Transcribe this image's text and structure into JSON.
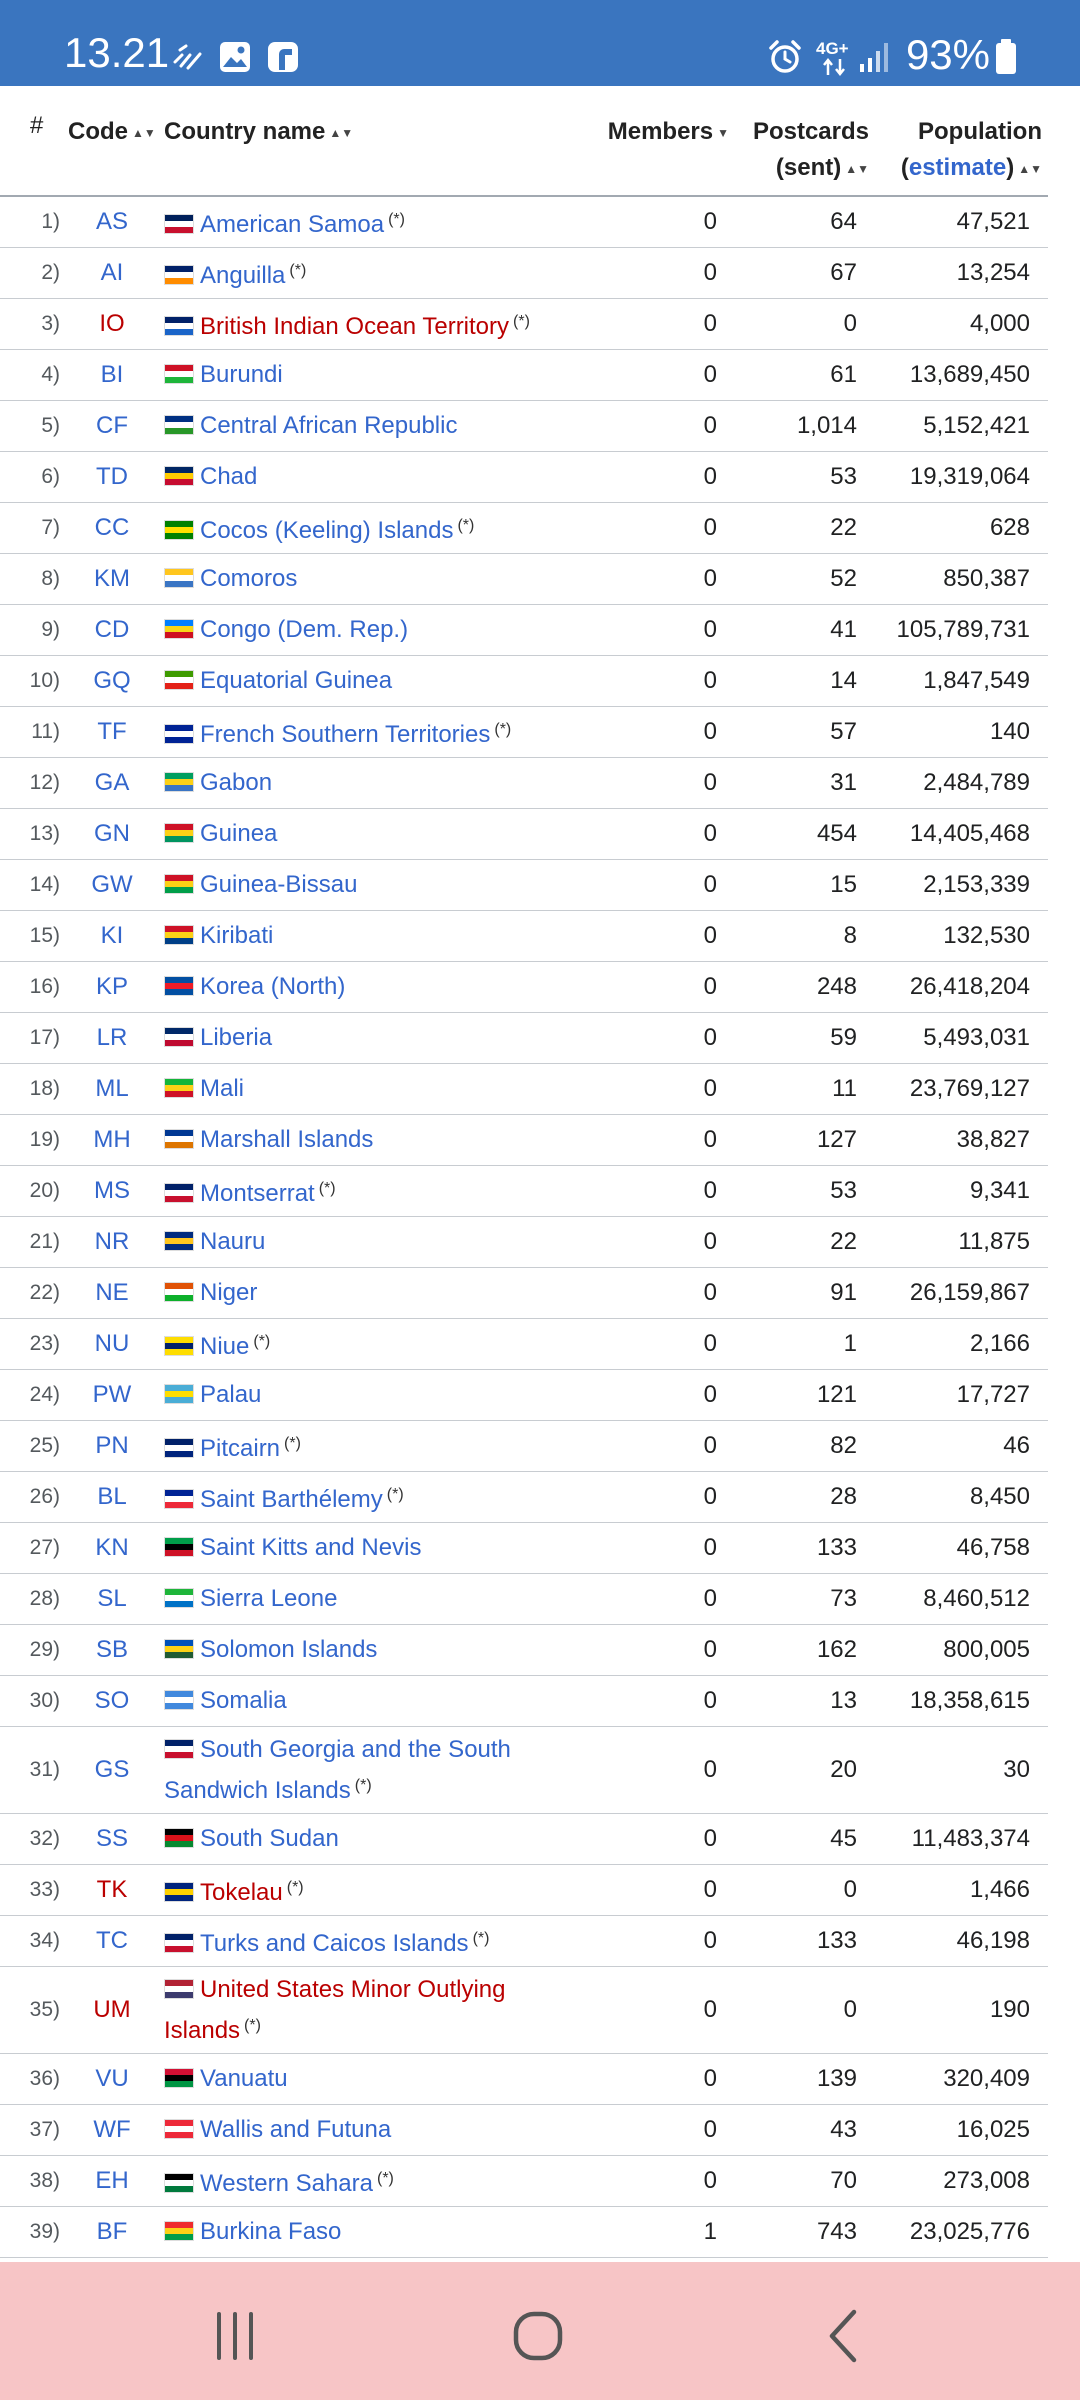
{
  "status_bar": {
    "time": "13.21",
    "network": "4G+",
    "battery": "93%",
    "icons": [
      "missed-call-icon",
      "gallery-icon",
      "app-f-icon",
      "alarm-icon",
      "network-4g-icon",
      "signal-icon",
      "battery-icon"
    ]
  },
  "table": {
    "headers": {
      "num": "#",
      "code": "Code",
      "name": "Country name",
      "members": "Members",
      "postcards_1": "Postcards",
      "postcards_2": "(sent)",
      "population_1": "Population",
      "population_open": "(",
      "population_link": "estimate",
      "population_close": ")"
    },
    "sort_glyph": "▲▼",
    "sort_glyph_members": "▼",
    "rows": [
      {
        "n": "1)",
        "code": "AS",
        "name": "American Samoa",
        "ast": "(*)",
        "members": "0",
        "postcards": "64",
        "population": "47,521",
        "flag": [
          "#00205b",
          "#ffffff",
          "#c8102e"
        ]
      },
      {
        "n": "2)",
        "code": "AI",
        "name": "Anguilla",
        "ast": "(*)",
        "members": "0",
        "postcards": "67",
        "population": "13,254",
        "flag": [
          "#012169",
          "#ffffff",
          "#ff8c00"
        ]
      },
      {
        "n": "3)",
        "code": "IO",
        "name": "British Indian Ocean Territory",
        "ast": "(*)",
        "members": "0",
        "postcards": "0",
        "population": "4,000",
        "flag": [
          "#012169",
          "#ffffff",
          "#1a64c8"
        ],
        "red": true
      },
      {
        "n": "4)",
        "code": "BI",
        "name": "Burundi",
        "ast": "",
        "members": "0",
        "postcards": "61",
        "population": "13,689,450",
        "flag": [
          "#ce1126",
          "#ffffff",
          "#1eb53a"
        ]
      },
      {
        "n": "5)",
        "code": "CF",
        "name": "Central African Republic",
        "ast": "",
        "members": "0",
        "postcards": "1,014",
        "population": "5,152,421",
        "flag": [
          "#003082",
          "#ffffff",
          "#289728"
        ]
      },
      {
        "n": "6)",
        "code": "TD",
        "name": "Chad",
        "ast": "",
        "members": "0",
        "postcards": "53",
        "population": "19,319,064",
        "flag": [
          "#002664",
          "#fecb00",
          "#c60c30"
        ]
      },
      {
        "n": "7)",
        "code": "CC",
        "name": "Cocos (Keeling) Islands",
        "ast": "(*)",
        "members": "0",
        "postcards": "22",
        "population": "628",
        "flag": [
          "#008000",
          "#ffe000",
          "#008000"
        ]
      },
      {
        "n": "8)",
        "code": "KM",
        "name": "Comoros",
        "ast": "",
        "members": "0",
        "postcards": "52",
        "population": "850,387",
        "flag": [
          "#ffc61e",
          "#ffffff",
          "#3a75c4"
        ]
      },
      {
        "n": "9)",
        "code": "CD",
        "name": "Congo (Dem. Rep.)",
        "ast": "",
        "members": "0",
        "postcards": "41",
        "population": "105,789,731",
        "flag": [
          "#007fff",
          "#f7d618",
          "#ce1021"
        ]
      },
      {
        "n": "10)",
        "code": "GQ",
        "name": "Equatorial Guinea",
        "ast": "",
        "members": "0",
        "postcards": "14",
        "population": "1,847,549",
        "flag": [
          "#3e9a00",
          "#ffffff",
          "#e32118"
        ]
      },
      {
        "n": "11)",
        "code": "TF",
        "name": "French Southern Territories",
        "ast": "(*)",
        "members": "0",
        "postcards": "57",
        "population": "140",
        "flag": [
          "#002395",
          "#ffffff",
          "#002395"
        ]
      },
      {
        "n": "12)",
        "code": "GA",
        "name": "Gabon",
        "ast": "",
        "members": "0",
        "postcards": "31",
        "population": "2,484,789",
        "flag": [
          "#009e60",
          "#fcd116",
          "#3a75c4"
        ]
      },
      {
        "n": "13)",
        "code": "GN",
        "name": "Guinea",
        "ast": "",
        "members": "0",
        "postcards": "454",
        "population": "14,405,468",
        "flag": [
          "#ce1126",
          "#fcd116",
          "#009460"
        ]
      },
      {
        "n": "14)",
        "code": "GW",
        "name": "Guinea-Bissau",
        "ast": "",
        "members": "0",
        "postcards": "15",
        "population": "2,153,339",
        "flag": [
          "#ce1126",
          "#fcd116",
          "#009e49"
        ]
      },
      {
        "n": "15)",
        "code": "KI",
        "name": "Kiribati",
        "ast": "",
        "members": "0",
        "postcards": "8",
        "population": "132,530",
        "flag": [
          "#ce1126",
          "#fcd116",
          "#003f87"
        ]
      },
      {
        "n": "16)",
        "code": "KP",
        "name": "Korea (North)",
        "ast": "",
        "members": "0",
        "postcards": "248",
        "population": "26,418,204",
        "flag": [
          "#024fa2",
          "#ed1c27",
          "#024fa2"
        ]
      },
      {
        "n": "17)",
        "code": "LR",
        "name": "Liberia",
        "ast": "",
        "members": "0",
        "postcards": "59",
        "population": "5,493,031",
        "flag": [
          "#002868",
          "#ffffff",
          "#bf0a30"
        ]
      },
      {
        "n": "18)",
        "code": "ML",
        "name": "Mali",
        "ast": "",
        "members": "0",
        "postcards": "11",
        "population": "23,769,127",
        "flag": [
          "#14b53a",
          "#fcd116",
          "#ce1126"
        ]
      },
      {
        "n": "19)",
        "code": "MH",
        "name": "Marshall Islands",
        "ast": "",
        "members": "0",
        "postcards": "127",
        "population": "38,827",
        "flag": [
          "#003893",
          "#ffffff",
          "#dd7500"
        ]
      },
      {
        "n": "20)",
        "code": "MS",
        "name": "Montserrat",
        "ast": "(*)",
        "members": "0",
        "postcards": "53",
        "population": "9,341",
        "flag": [
          "#012169",
          "#ffffff",
          "#c8102e"
        ]
      },
      {
        "n": "21)",
        "code": "NR",
        "name": "Nauru",
        "ast": "",
        "members": "0",
        "postcards": "22",
        "population": "11,875",
        "flag": [
          "#002b7f",
          "#ffc61e",
          "#002b7f"
        ]
      },
      {
        "n": "22)",
        "code": "NE",
        "name": "Niger",
        "ast": "",
        "members": "0",
        "postcards": "91",
        "population": "26,159,867",
        "flag": [
          "#e05206",
          "#ffffff",
          "#0db02b"
        ]
      },
      {
        "n": "23)",
        "code": "NU",
        "name": "Niue",
        "ast": "(*)",
        "members": "0",
        "postcards": "1",
        "population": "2,166",
        "flag": [
          "#fedd00",
          "#012169",
          "#fedd00"
        ]
      },
      {
        "n": "24)",
        "code": "PW",
        "name": "Palau",
        "ast": "",
        "members": "0",
        "postcards": "121",
        "population": "17,727",
        "flag": [
          "#4aadd6",
          "#ffde00",
          "#4aadd6"
        ]
      },
      {
        "n": "25)",
        "code": "PN",
        "name": "Pitcairn",
        "ast": "(*)",
        "members": "0",
        "postcards": "82",
        "population": "46",
        "flag": [
          "#012169",
          "#ffffff",
          "#00247d"
        ]
      },
      {
        "n": "26)",
        "code": "BL",
        "name": "Saint Barthélemy",
        "ast": "(*)",
        "members": "0",
        "postcards": "28",
        "population": "8,450",
        "flag": [
          "#002395",
          "#ffffff",
          "#ed2939"
        ]
      },
      {
        "n": "27)",
        "code": "KN",
        "name": "Saint Kitts and Nevis",
        "ast": "",
        "members": "0",
        "postcards": "133",
        "population": "46,758",
        "flag": [
          "#009e49",
          "#000000",
          "#ce1126"
        ]
      },
      {
        "n": "28)",
        "code": "SL",
        "name": "Sierra Leone",
        "ast": "",
        "members": "0",
        "postcards": "73",
        "population": "8,460,512",
        "flag": [
          "#1eb53a",
          "#ffffff",
          "#0072c6"
        ]
      },
      {
        "n": "29)",
        "code": "SB",
        "name": "Solomon Islands",
        "ast": "",
        "members": "0",
        "postcards": "162",
        "population": "800,005",
        "flag": [
          "#0051ba",
          "#fcd116",
          "#215b33"
        ]
      },
      {
        "n": "30)",
        "code": "SO",
        "name": "Somalia",
        "ast": "",
        "members": "0",
        "postcards": "13",
        "population": "18,358,615",
        "flag": [
          "#4189dd",
          "#ffffff",
          "#4189dd"
        ]
      },
      {
        "n": "31)",
        "code": "GS",
        "name": "South Georgia and the South Sandwich Islands",
        "ast": "(*)",
        "members": "0",
        "postcards": "20",
        "population": "30",
        "flag": [
          "#012169",
          "#ffffff",
          "#c8102e"
        ],
        "tall": true
      },
      {
        "n": "32)",
        "code": "SS",
        "name": "South Sudan",
        "ast": "",
        "members": "0",
        "postcards": "45",
        "population": "11,483,374",
        "flag": [
          "#000000",
          "#da121a",
          "#078930"
        ]
      },
      {
        "n": "33)",
        "code": "TK",
        "name": "Tokelau",
        "ast": "(*)",
        "members": "0",
        "postcards": "0",
        "population": "1,466",
        "flag": [
          "#00247d",
          "#fed100",
          "#00247d"
        ],
        "red": true
      },
      {
        "n": "34)",
        "code": "TC",
        "name": "Turks and Caicos Islands",
        "ast": "(*)",
        "members": "0",
        "postcards": "133",
        "population": "46,198",
        "flag": [
          "#012169",
          "#ffffff",
          "#c8102e"
        ]
      },
      {
        "n": "35)",
        "code": "UM",
        "name": "United States Minor Outlying Islands",
        "ast": "(*)",
        "members": "0",
        "postcards": "0",
        "population": "190",
        "flag": [
          "#b22234",
          "#ffffff",
          "#3c3b6e"
        ],
        "red": true,
        "tall": true
      },
      {
        "n": "36)",
        "code": "VU",
        "name": "Vanuatu",
        "ast": "",
        "members": "0",
        "postcards": "139",
        "population": "320,409",
        "flag": [
          "#d21034",
          "#000000",
          "#009543"
        ]
      },
      {
        "n": "37)",
        "code": "WF",
        "name": "Wallis and Futuna",
        "ast": "",
        "members": "0",
        "postcards": "43",
        "population": "16,025",
        "flag": [
          "#ed2939",
          "#ffffff",
          "#ed2939"
        ]
      },
      {
        "n": "38)",
        "code": "EH",
        "name": "Western Sahara",
        "ast": "(*)",
        "members": "0",
        "postcards": "70",
        "population": "273,008",
        "flag": [
          "#000000",
          "#ffffff",
          "#007a3d"
        ]
      },
      {
        "n": "39)",
        "code": "BF",
        "name": "Burkina Faso",
        "ast": "",
        "members": "1",
        "postcards": "743",
        "population": "23,025,776",
        "flag": [
          "#ef2b2d",
          "#fcd116",
          "#009e49"
        ]
      }
    ]
  },
  "nav_bar": {
    "icons": [
      "recent-apps-icon",
      "home-icon",
      "back-icon"
    ]
  }
}
